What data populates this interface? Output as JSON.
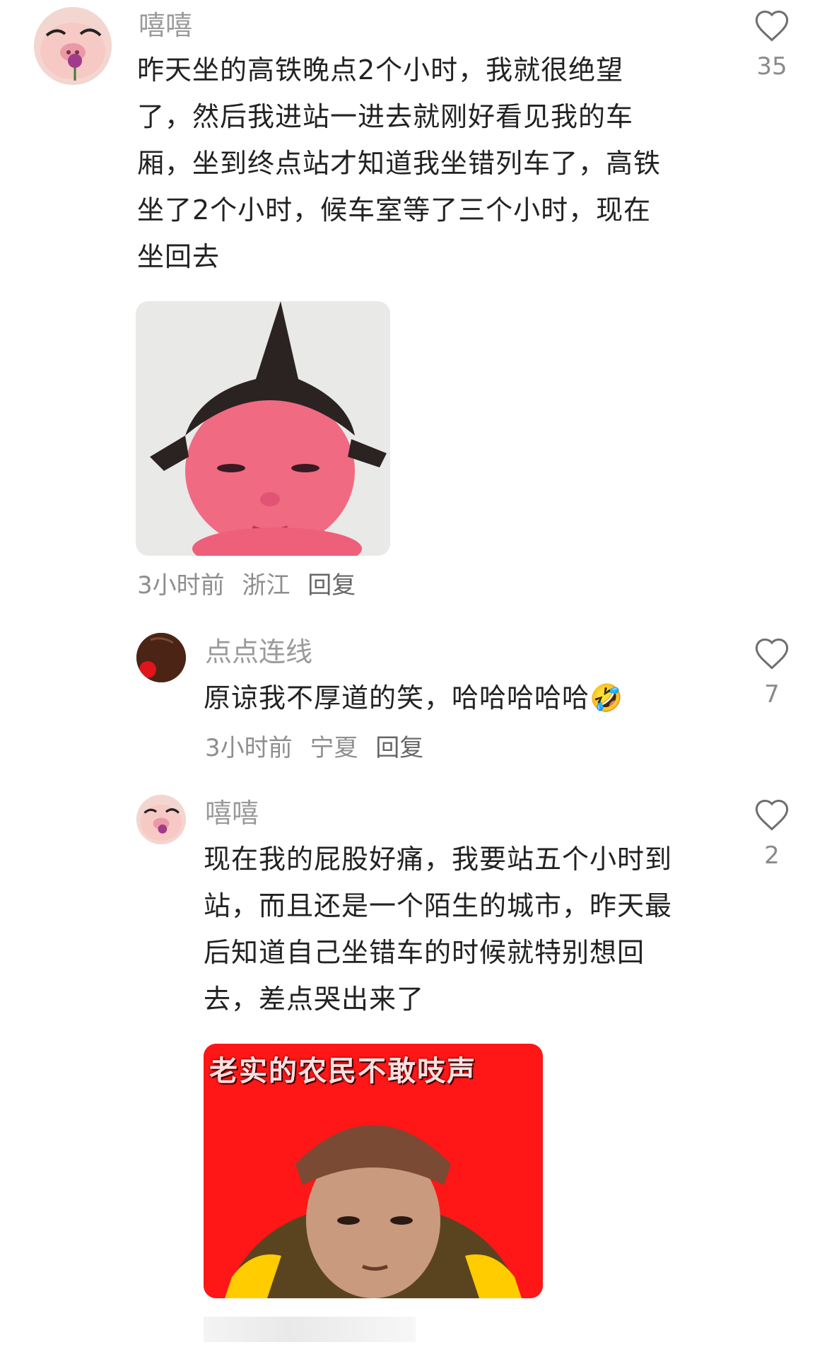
{
  "comments": [
    {
      "username": "嘻嘻",
      "text": "昨天坐的高铁晚点2个小时，我就很绝望了，然后我进站一进去就刚好看见我的车厢，坐到终点站才知道我坐错列车了，高铁坐了2个小时，候车室等了三个小时，现在坐回去",
      "lines": [
        "昨天坐的高铁晚点2个小时，我就很绝望",
        "了，然后我进站一进去就刚好看见我的车",
        "厢，坐到终点站才知道我坐错列车了，高铁",
        "坐了2个小时，候车室等了三个小时，现在",
        "坐回去"
      ],
      "time": "3小时前",
      "location": "浙江",
      "reply_label": "回复",
      "likes": "35"
    },
    {
      "username": "点点连线",
      "text": "原谅我不厚道的笑，哈哈哈哈哈🤣",
      "time": "3小时前",
      "location": "宁夏",
      "reply_label": "回复",
      "likes": "7"
    },
    {
      "username": "嘻嘻",
      "text": "现在我的屁股好痛，我要站五个小时到站，而且还是一个陌生的城市，昨天最后知道自己坐错车的时候就特别想回去，差点哭出来了",
      "lines": [
        "现在我的屁股好痛，我要站五个小时到",
        "站，而且还是一个陌生的城市，昨天最",
        "后知道自己坐错车的时候就特别想回",
        "去，差点哭出来了"
      ],
      "likes": "2",
      "sticker_caption": "老实的农民不敢吱声"
    }
  ],
  "icons": {
    "like": "heart-outline-icon"
  },
  "colors": {
    "username": "#9a9a9a",
    "meta": "#8e8e8e",
    "sticker_red": "#ff1a1a"
  }
}
